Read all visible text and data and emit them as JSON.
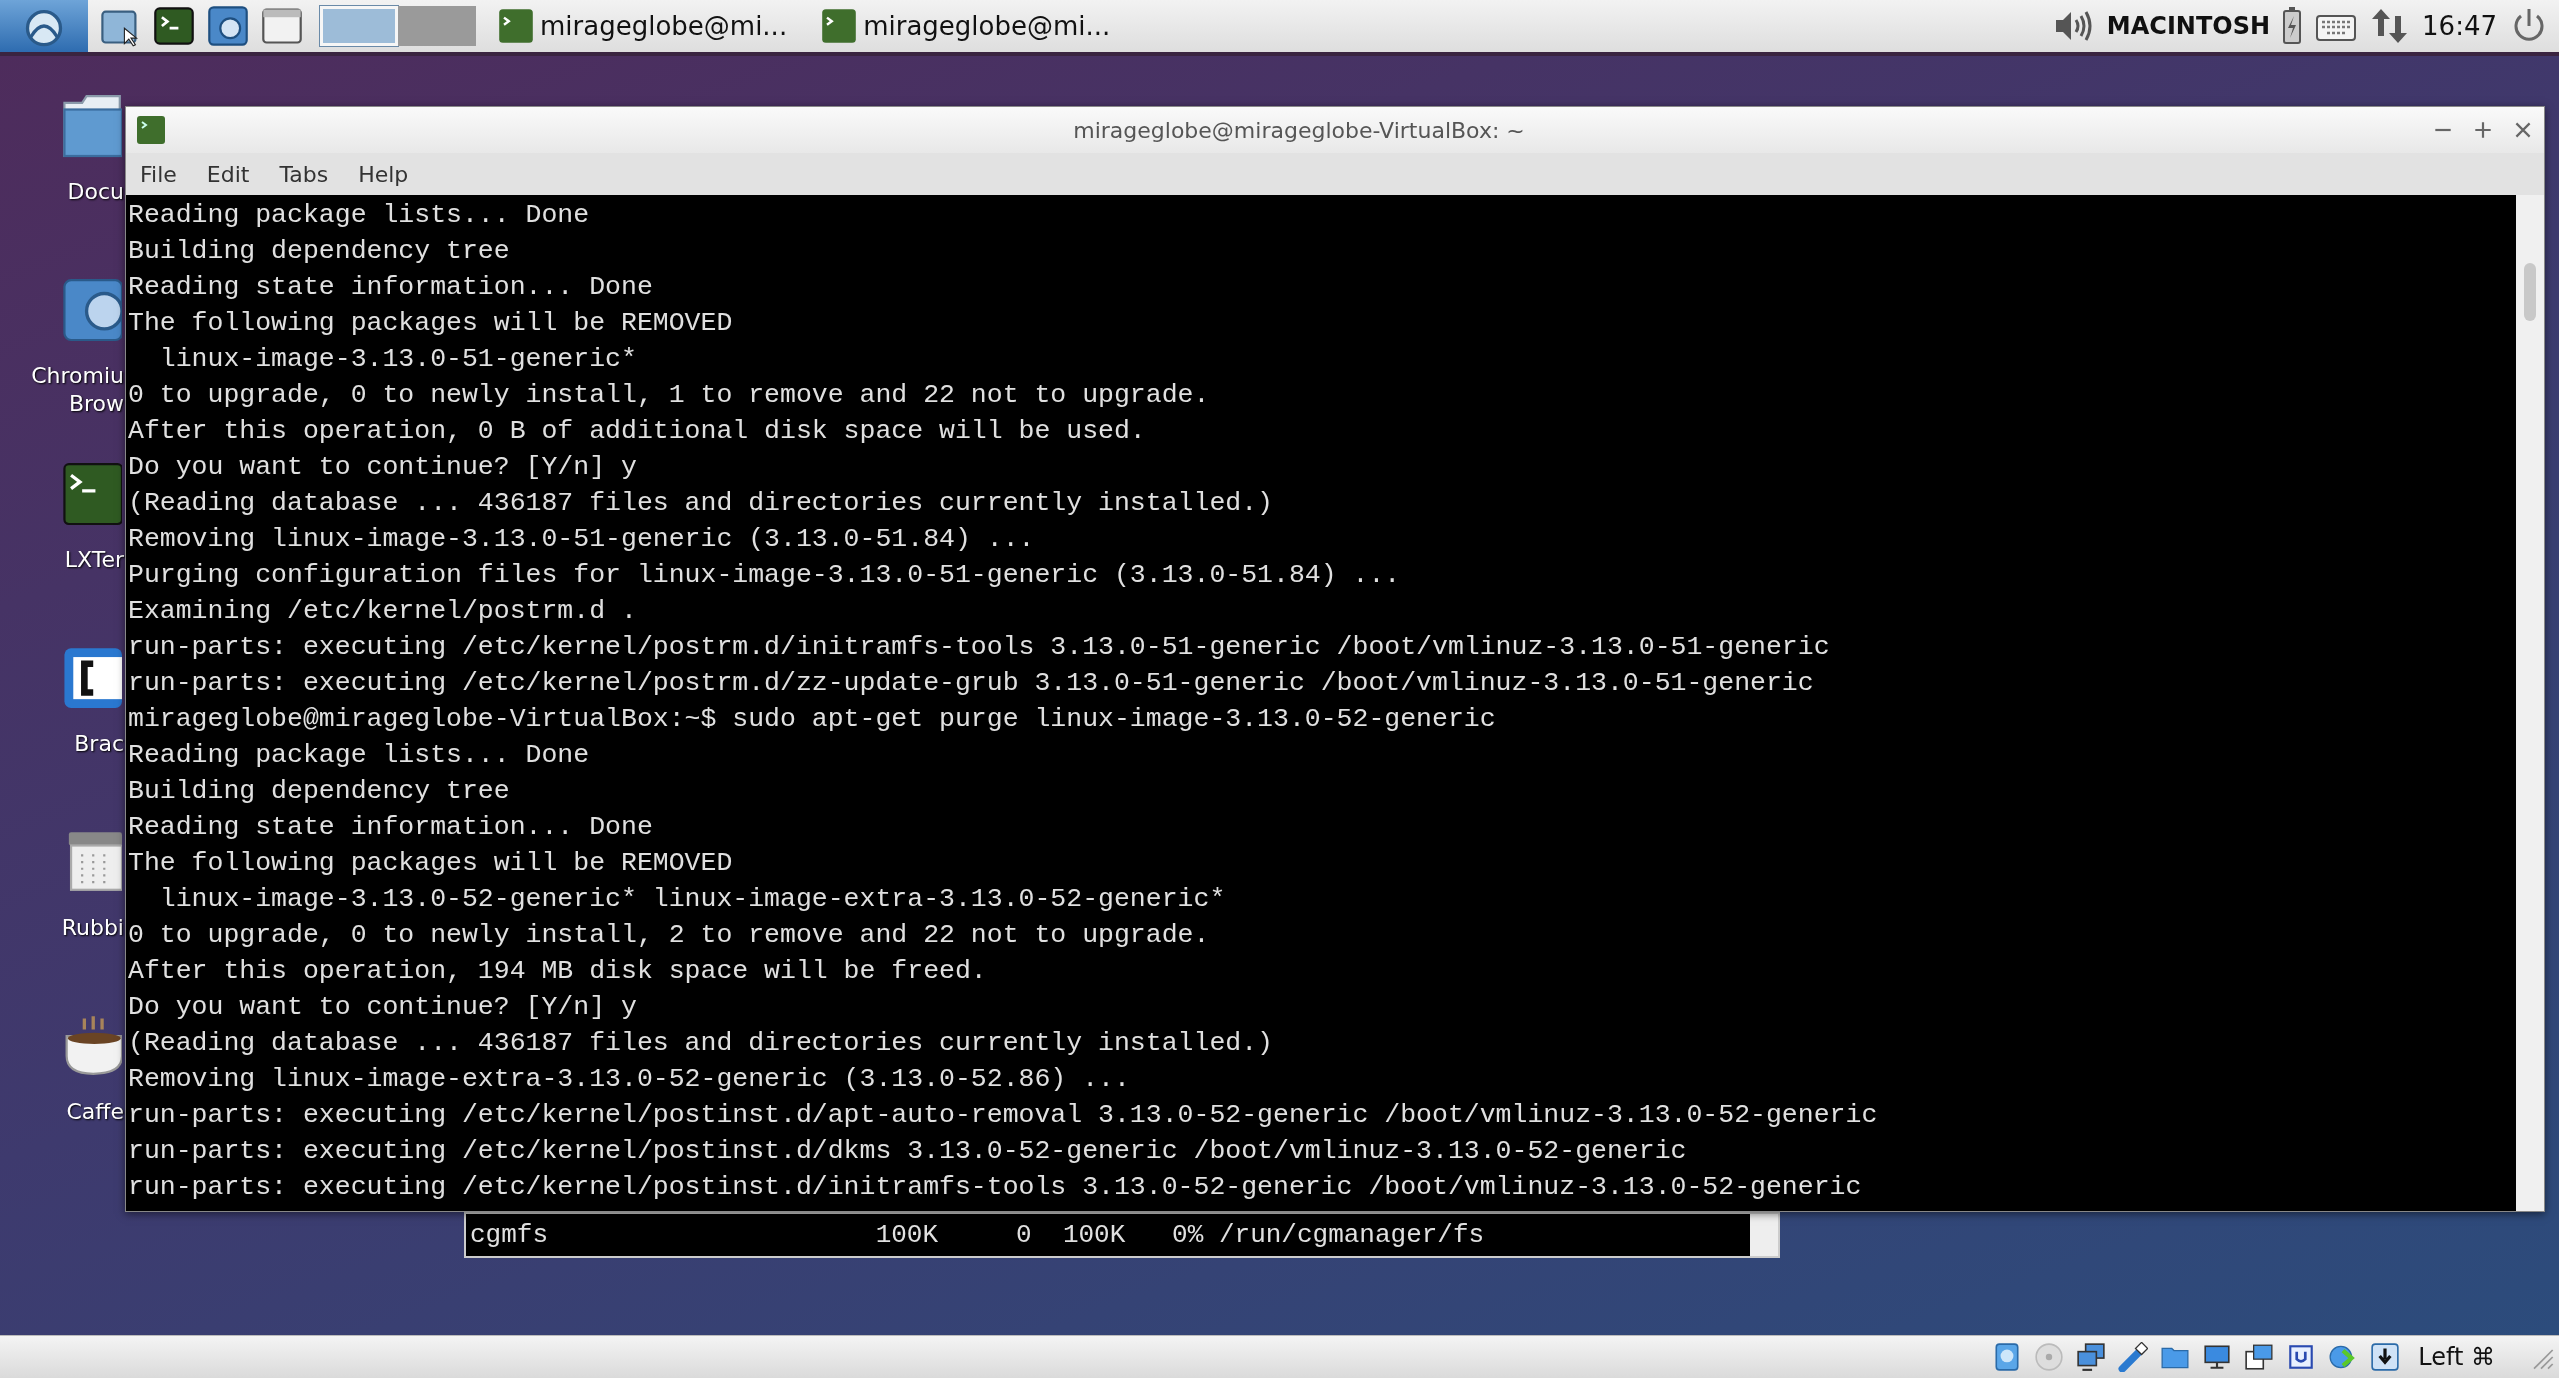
{
  "taskbar": {
    "workspaces": [
      {
        "selected": true
      },
      {
        "selected": false
      }
    ],
    "tasks": [
      {
        "label": "mirageglobe@mi..."
      },
      {
        "label": "mirageglobe@mi..."
      }
    ],
    "keyboard_layout": "MACINTOSH",
    "clock": "16:47"
  },
  "desktop_icons": [
    {
      "kind": "folder",
      "lines": [
        "Docu"
      ]
    },
    {
      "kind": "browser",
      "lines": [
        "Chromiu",
        "Brow"
      ]
    },
    {
      "kind": "terminal",
      "lines": [
        "LXTer"
      ]
    },
    {
      "kind": "editor",
      "lines": [
        "Brac"
      ]
    },
    {
      "kind": "trash",
      "lines": [
        "Rubbi"
      ]
    },
    {
      "kind": "cup",
      "lines": [
        "Caffe"
      ]
    }
  ],
  "window": {
    "title": "mirageglobe@mirageglobe-VirtualBox: ~",
    "menu": [
      "File",
      "Edit",
      "Tabs",
      "Help"
    ],
    "terminal_lines": [
      "Reading package lists... Done",
      "Building dependency tree",
      "Reading state information... Done",
      "The following packages will be REMOVED",
      "  linux-image-3.13.0-51-generic*",
      "0 to upgrade, 0 to newly install, 1 to remove and 22 not to upgrade.",
      "After this operation, 0 B of additional disk space will be used.",
      "Do you want to continue? [Y/n] y",
      "(Reading database ... 436187 files and directories currently installed.)",
      "Removing linux-image-3.13.0-51-generic (3.13.0-51.84) ...",
      "Purging configuration files for linux-image-3.13.0-51-generic (3.13.0-51.84) ...",
      "Examining /etc/kernel/postrm.d .",
      "run-parts: executing /etc/kernel/postrm.d/initramfs-tools 3.13.0-51-generic /boot/vmlinuz-3.13.0-51-generic",
      "run-parts: executing /etc/kernel/postrm.d/zz-update-grub 3.13.0-51-generic /boot/vmlinuz-3.13.0-51-generic",
      "mirageglobe@mirageglobe-VirtualBox:~$ sudo apt-get purge linux-image-3.13.0-52-generic",
      "Reading package lists... Done",
      "Building dependency tree",
      "Reading state information... Done",
      "The following packages will be REMOVED",
      "  linux-image-3.13.0-52-generic* linux-image-extra-3.13.0-52-generic*",
      "0 to upgrade, 0 to newly install, 2 to remove and 22 not to upgrade.",
      "After this operation, 194 MB disk space will be freed.",
      "Do you want to continue? [Y/n] y",
      "(Reading database ... 436187 files and directories currently installed.)",
      "Removing linux-image-extra-3.13.0-52-generic (3.13.0-52.86) ...",
      "run-parts: executing /etc/kernel/postinst.d/apt-auto-removal 3.13.0-52-generic /boot/vmlinuz-3.13.0-52-generic",
      "run-parts: executing /etc/kernel/postinst.d/dkms 3.13.0-52-generic /boot/vmlinuz-3.13.0-52-generic",
      "run-parts: executing /etc/kernel/postinst.d/initramfs-tools 3.13.0-52-generic /boot/vmlinuz-3.13.0-52-generic"
    ]
  },
  "background_window": {
    "line": "cgmfs                     100K     0  100K   0% /run/cgmanager/fs"
  },
  "vm_status_bar": {
    "host_key": "Left ⌘"
  }
}
